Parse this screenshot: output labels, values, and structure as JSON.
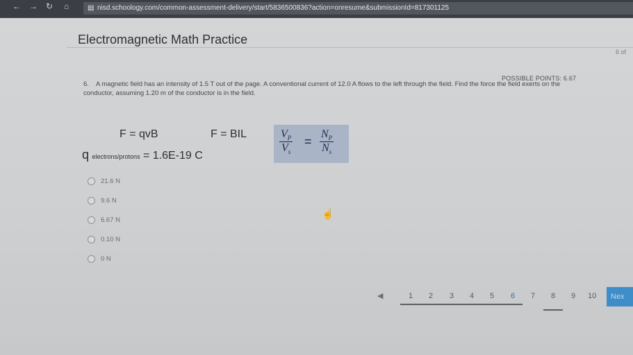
{
  "browser": {
    "url": "nisd.schoology.com/common-assessment-delivery/start/5836500836?action=onresume&submissionId=817301125"
  },
  "header": {
    "title": "Electromagnetic Math Practice",
    "page_count": "6 of"
  },
  "question": {
    "possible_points": "POSSIBLE POINTS: 6.67",
    "number": "6.",
    "text": "A magnetic field has an intensity of 1.5 T out of the page. A conventional current of 12.0 A flows to the left through the field. Find the force the field exerts on the conductor, assuming 1.20 m of the conductor is in the field."
  },
  "formulas": {
    "f1": "F = qvB",
    "f2": "F = BIL",
    "charge_symbol": "q",
    "charge_sub": "electrons/protons",
    "charge_value": "= 1.6E-19 C",
    "ratio": {
      "left_num": "V",
      "left_num_sub": "P",
      "left_den": "V",
      "left_den_sub": "s",
      "eq": "=",
      "right_num": "N",
      "right_num_sub": "P",
      "right_den": "N",
      "right_den_sub": "s"
    }
  },
  "choices": [
    {
      "label": "21.6 N"
    },
    {
      "label": "9.6 N"
    },
    {
      "label": "6.67 N"
    },
    {
      "label": "0.10 N"
    },
    {
      "label": "0 N"
    }
  ],
  "pagination": {
    "prev": "◀",
    "pages": [
      "1",
      "2",
      "3",
      "4",
      "5",
      "6",
      "7",
      "8",
      "9",
      "10"
    ],
    "active": "6",
    "next_label": "Nex"
  },
  "icons": {
    "back": "←",
    "forward": "→",
    "reload": "↻",
    "home": "⌂",
    "cursor": "☝"
  }
}
